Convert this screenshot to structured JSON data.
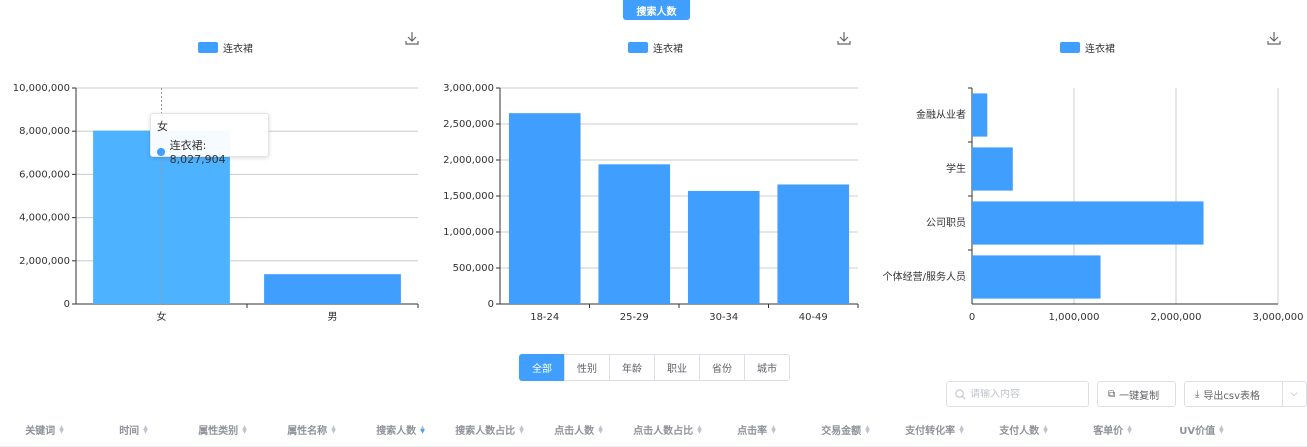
{
  "top_button": "搜索人数",
  "chart_data": [
    {
      "type": "bar",
      "legend": [
        "连衣裙"
      ],
      "categories": [
        "女",
        "男"
      ],
      "series": [
        {
          "name": "连衣裙",
          "values": [
            8027904,
            1380000
          ]
        }
      ],
      "ylim": [
        0,
        10000000
      ],
      "yticks": [
        "0",
        "2,000,000",
        "4,000,000",
        "6,000,000",
        "8,000,000",
        "10,000,000"
      ],
      "tooltip": {
        "title": "女",
        "label": "连衣裙: 8,027,904"
      }
    },
    {
      "type": "bar",
      "legend": [
        "连衣裙"
      ],
      "categories": [
        "18-24",
        "25-29",
        "30-34",
        "40-49"
      ],
      "series": [
        {
          "name": "连衣裙",
          "values": [
            2650000,
            1940000,
            1570000,
            1660000
          ]
        }
      ],
      "ylim": [
        0,
        3000000
      ],
      "yticks": [
        "0",
        "500,000",
        "1,000,000",
        "1,500,000",
        "2,000,000",
        "2,500,000",
        "3,000,000"
      ]
    },
    {
      "type": "bar",
      "orientation": "horizontal",
      "legend": [
        "连衣裙"
      ],
      "categories": [
        "金融从业者",
        "学生",
        "公司职员",
        "个体经营/服务人员"
      ],
      "series": [
        {
          "name": "连衣裙",
          "values": [
            150000,
            400000,
            2270000,
            1260000
          ]
        }
      ],
      "xlim": [
        0,
        3000000
      ],
      "xticks": [
        "0",
        "1,000,000",
        "2,000,000",
        "3,000,000"
      ]
    }
  ],
  "tabs": [
    "全部",
    "性别",
    "年龄",
    "职业",
    "省份",
    "城市"
  ],
  "search": {
    "placeholder": "请输入内容"
  },
  "copy_button": "一键复制",
  "export_button": "导出csv表格",
  "columns": [
    "关键词",
    "时间",
    "属性类别",
    "属性名称",
    "搜索人数",
    "搜索人数占比",
    "点击人数",
    "点击人数占比",
    "点击率",
    "交易金额",
    "支付转化率",
    "支付人数",
    "客单价",
    "UV价值"
  ],
  "sorted_column": "搜索人数",
  "colors": {
    "accent": "#409eff",
    "bar_hover": "#4db2ff"
  }
}
